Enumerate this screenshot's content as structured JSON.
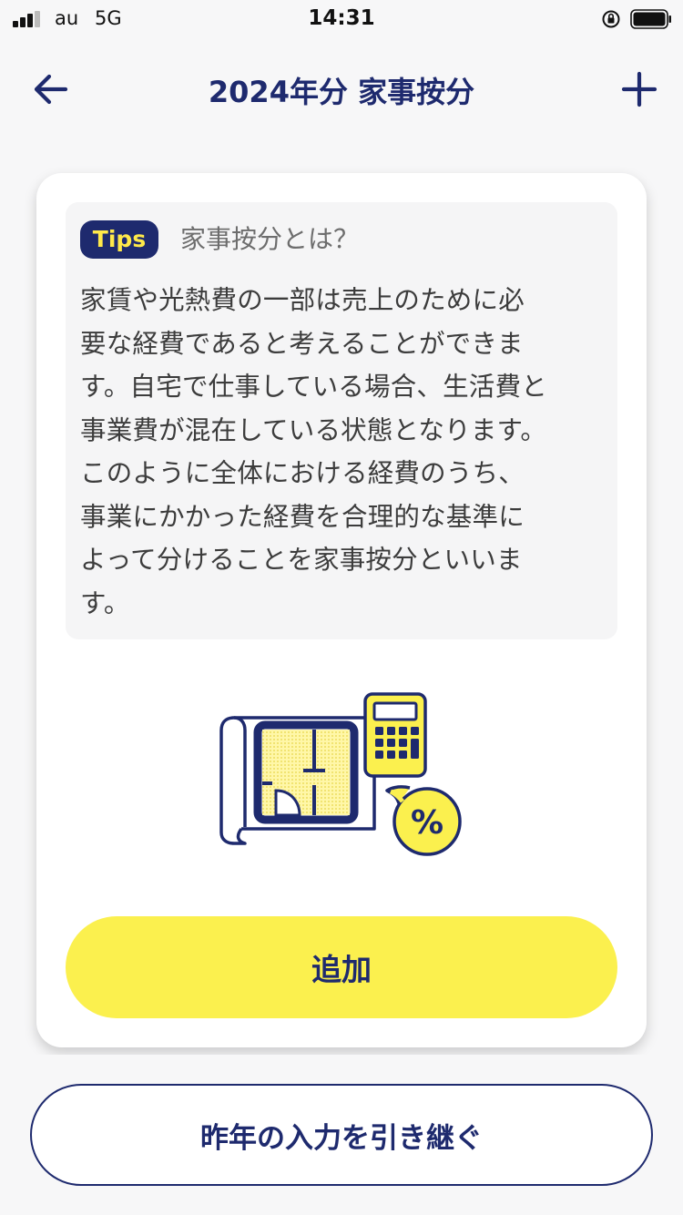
{
  "status_bar": {
    "carrier": "au",
    "network": "5G",
    "time": "14:31"
  },
  "header": {
    "title": "2024年分 家事按分",
    "back_icon": "arrow-left-icon",
    "add_icon": "plus-icon"
  },
  "tips": {
    "badge": "Tips",
    "title": "家事按分とは？",
    "lines": [
      "家賃や光熱費の一部は売上のために必",
      "要な経費であると考えることができま",
      "す。自宅で仕事している場合、生活費と",
      "事業費が混在している状態となります。",
      "このように全体における経費のうち、",
      "事業にかかった経費を合理的な基準に",
      "よって分けることを家事按分といいま",
      "す。"
    ]
  },
  "illustration": {
    "icon": "floorplan-calculator-percent-illustration",
    "percent_symbol": "%"
  },
  "actions": {
    "add_label": "追加",
    "carry_over_label": "昨年の入力を引き継ぐ"
  },
  "colors": {
    "navy": "#1e2a6e",
    "yellow": "#fbf04e",
    "badge_text": "#ffe94a",
    "background": "#f7f7f8"
  }
}
